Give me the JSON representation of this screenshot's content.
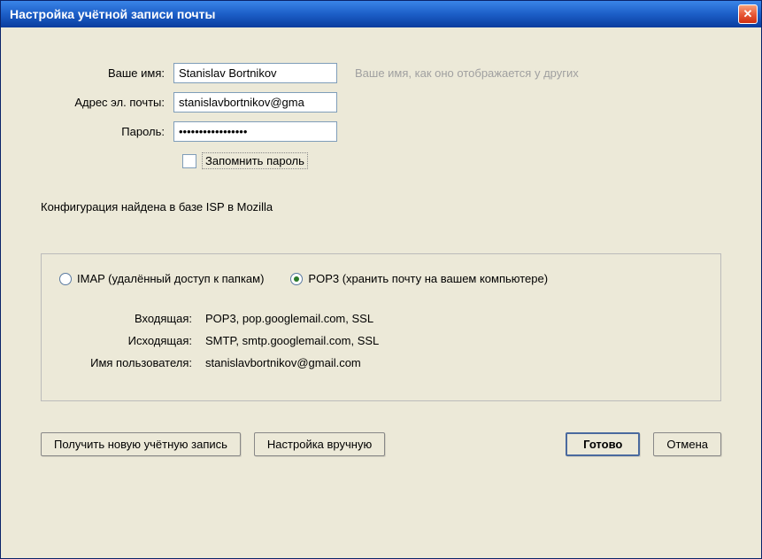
{
  "window": {
    "title": "Настройка учётной записи почты"
  },
  "form": {
    "name_label": "Ваше имя:",
    "name_value": "Stanislav Bortnikov",
    "name_hint": "Ваше имя, как оно отображается у других",
    "email_label": "Адрес эл. почты:",
    "email_value": "stanislavbortnikov@gma",
    "password_label": "Пароль:",
    "password_value": "•••••••••••••••••",
    "remember_label": "Запомнить пароль"
  },
  "status": "Конфигурация найдена в базе ISP в Mozilla",
  "config": {
    "imap_label": "IMAP (удалённый доступ к папкам)",
    "pop3_label": "POP3 (хранить почту на вашем компьютере)",
    "incoming_label": "Входящая:",
    "incoming_value": "POP3, pop.googlemail.com, SSL",
    "outgoing_label": "Исходящая:",
    "outgoing_value": "SMTP, smtp.googlemail.com, SSL",
    "username_label": "Имя пользователя:",
    "username_value": "stanislavbortnikov@gmail.com"
  },
  "buttons": {
    "new_account": "Получить новую учётную запись",
    "manual": "Настройка вручную",
    "done": "Готово",
    "cancel": "Отмена"
  }
}
